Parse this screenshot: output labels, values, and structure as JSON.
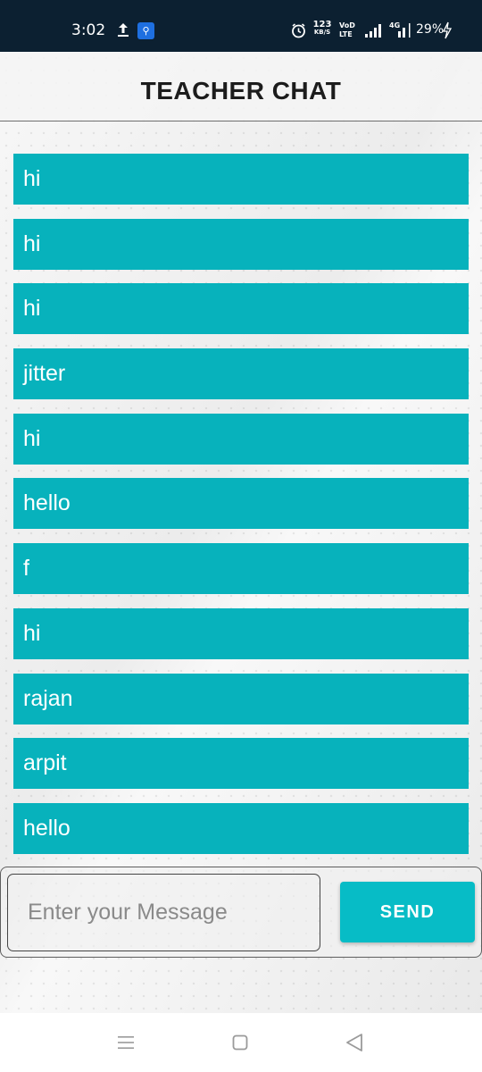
{
  "status_bar": {
    "time": "3:02",
    "net_speed_value": "123",
    "net_speed_unit": "KB/S",
    "volte_top": "VoD",
    "volte_bottom": "LTE",
    "lte_label": "4G",
    "battery": "29%",
    "icons": [
      "upload-icon",
      "usb-icon",
      "alarm-icon",
      "signal-icon",
      "charge-icon"
    ]
  },
  "header": {
    "title": "TEACHER CHAT"
  },
  "messages": [
    {
      "text": "hi"
    },
    {
      "text": "hi"
    },
    {
      "text": "hi"
    },
    {
      "text": "jitter"
    },
    {
      "text": "hi"
    },
    {
      "text": "hello"
    },
    {
      "text": "f"
    },
    {
      "text": "hi"
    },
    {
      "text": "rajan"
    },
    {
      "text": "arpit"
    },
    {
      "text": "hello"
    }
  ],
  "composer": {
    "placeholder": "Enter your Message",
    "value": "",
    "send_label": "SEND"
  },
  "nav_bar": {
    "icons": [
      "menu-icon",
      "home-icon",
      "back-icon"
    ]
  },
  "colors": {
    "status_bar_bg": "#0c2031",
    "message_bg": "#07b2bc",
    "send_bg": "#07bcc6",
    "usb_badge": "#1e6fe0"
  }
}
